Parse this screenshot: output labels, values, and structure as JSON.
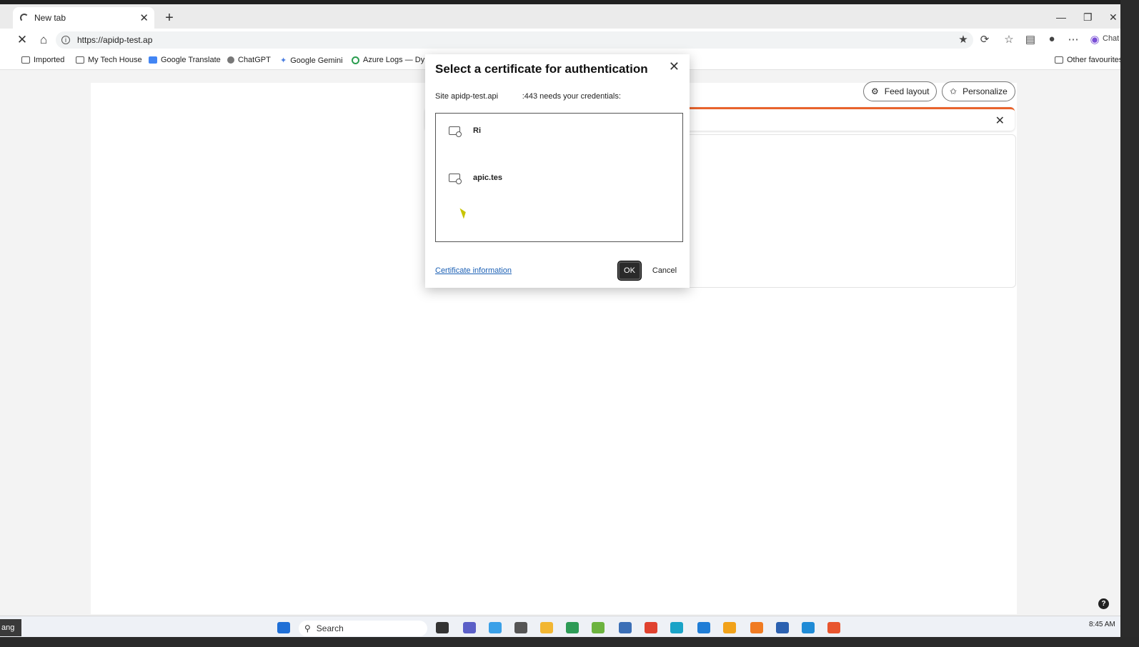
{
  "browser": {
    "tab_title": "New tab",
    "url": "https://apidp-test.ap",
    "bookmarks": [
      "Imported",
      "My Tech House",
      "Google Translate",
      "ChatGPT",
      "Google Gemini",
      "Azure Logs — Dyn...",
      "Other favourites"
    ],
    "copilot_label": "Chat"
  },
  "newtab": {
    "feed_layout": "Feed layout",
    "personalize": "Personalize"
  },
  "dialog": {
    "title": "Select a certificate for authentication",
    "site_prefix": "Site apidp-test.api",
    "site_suffix": ":443 needs your credentials:",
    "certificates": [
      "Ri",
      "apic.tes"
    ],
    "cert_info_link": "Certificate information",
    "ok": "OK",
    "cancel": "Cancel"
  },
  "taskbar": {
    "search_placeholder": "Search",
    "time": "8:45 AM",
    "left_label": "ang"
  },
  "colors": {
    "alert_accent": "#e8632c",
    "link": "#1a5fb4"
  }
}
